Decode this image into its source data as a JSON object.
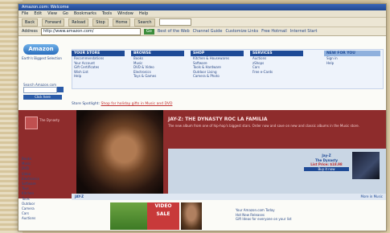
{
  "browser": {
    "title": "Amazon.com: Welcome",
    "menu": [
      "File",
      "Edit",
      "View",
      "Go",
      "Bookmarks",
      "Tools",
      "Window",
      "Help"
    ],
    "toolbar": [
      "Back",
      "Forward",
      "Reload",
      "Stop",
      "Home",
      "Search"
    ],
    "address_label": "Address",
    "address_url": "http://www.amazon.com/",
    "go_label": "Go",
    "links": [
      "Best of the Web",
      "Channel Guide",
      "Customize Links",
      "Free Hotmail",
      "Internet Start"
    ]
  },
  "logo": {
    "text": "Amazon",
    "tagline": "Earth's Biggest Selection"
  },
  "search": {
    "label": "Search Amazon.com",
    "go": "GO"
  },
  "sidebar_promo": "Click here",
  "nav": [
    {
      "head": "YOUR STORE",
      "items": [
        "Recommendations",
        "Your Account",
        "Gift Certificates",
        "Wish List",
        "Help"
      ]
    },
    {
      "head": "BROWSE",
      "items": [
        "Books",
        "Music",
        "DVD & Video",
        "Electronics",
        "Toys & Games"
      ]
    },
    {
      "head": "SHOP",
      "items": [
        "Kitchen & Housewares",
        "Software",
        "Tools & Hardware",
        "Outdoor Living",
        "Camera & Photo"
      ]
    },
    {
      "head": "SERVICES",
      "items": [
        "Auctions",
        "zShops",
        "Cars",
        "Free e-Cards"
      ]
    },
    {
      "head": "NEW FOR YOU",
      "items": [
        "Sign in",
        "Help"
      ]
    }
  ],
  "spotlight": {
    "label": "Store Spotlight:",
    "link": "Shop for holiday gifts in Music and DVD"
  },
  "hero": {
    "sub": "The Dynasty",
    "headline": "JAY-Z: THE DYNASTY ROC LA FAMILIA",
    "copy": "The new album from one of hip-hop's biggest stars. Order now and save on new and classic albums in the Music store.",
    "price": {
      "label": "Jay-Z",
      "title": "The Dynasty",
      "sale": "List Price: $18.98",
      "buy": "Buy it now"
    }
  },
  "left_nav": [
    "Books",
    "Music",
    "DVD",
    "Video",
    "Electronics",
    "Software",
    "Toys",
    "Kitchen",
    "Tools",
    "Outdoor",
    "Camera",
    "Cars",
    "Auctions"
  ],
  "caption": {
    "left": "JAY-Z",
    "right": "More in Music"
  },
  "promo": {
    "red": "VIDEO SALE"
  },
  "bottom_text": [
    "Your Amazon.com Today",
    "Hot New Releases",
    "Gift Ideas for everyone on your list"
  ]
}
